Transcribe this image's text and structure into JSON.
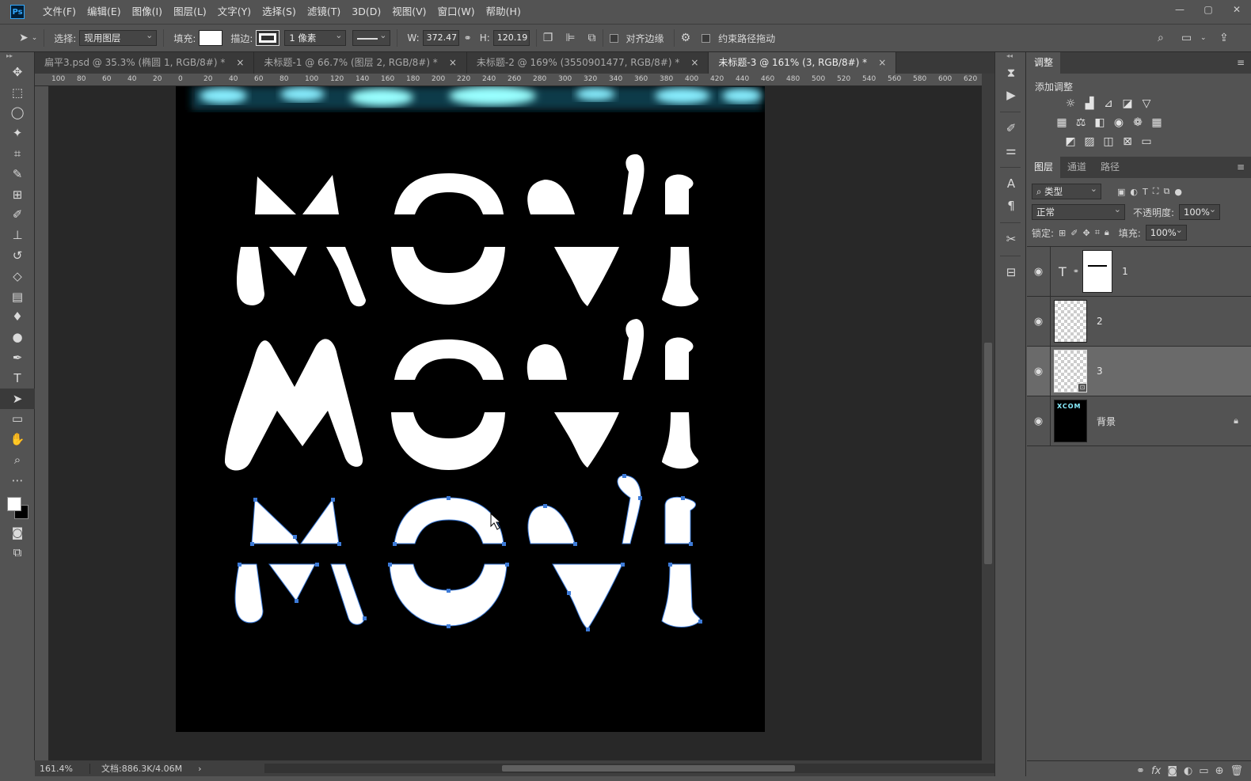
{
  "menubar": {
    "logo": "Ps",
    "items": [
      "文件(F)",
      "编辑(E)",
      "图像(I)",
      "图层(L)",
      "文字(Y)",
      "选择(S)",
      "滤镜(T)",
      "3D(D)",
      "视图(V)",
      "窗口(W)",
      "帮助(H)"
    ]
  },
  "options": {
    "select_label": "选择:",
    "select_value": "现用图层",
    "fill_label": "填充:",
    "stroke_label": "描边:",
    "stroke_width": "1 像素",
    "w_label": "W:",
    "w_value": "372.47 |",
    "h_label": "H:",
    "h_value": "120.19 |",
    "align_edges": "对齐边缘",
    "constrain_path": "约束路径拖动"
  },
  "tabs": [
    {
      "label": "扁平3.psd @ 35.3% (椭圆 1, RGB/8#) *",
      "close": "×"
    },
    {
      "label": "未标题-1 @ 66.7% (图层 2, RGB/8#) *",
      "close": "×"
    },
    {
      "label": "未标题-2 @ 169% (3550901477, RGB/8#) *",
      "close": "×"
    },
    {
      "label": "未标题-3 @ 161% (3, RGB/8#) *",
      "close": "×"
    }
  ],
  "ruler_top": [
    "100",
    "80",
    "60",
    "40",
    "20",
    "0",
    "20",
    "40",
    "60",
    "80",
    "100",
    "120",
    "140",
    "160",
    "180",
    "200",
    "220",
    "240",
    "260",
    "280",
    "300",
    "320",
    "340",
    "360",
    "380",
    "400",
    "420",
    "440",
    "460",
    "480",
    "500",
    "520",
    "540",
    "560",
    "580",
    "600",
    "620"
  ],
  "canvas": {
    "word": "MOVI"
  },
  "status": {
    "zoom": "161.4%",
    "doc_info": "文档:886.3K/4.06M"
  },
  "adjust_panel": {
    "tab": "调整",
    "add_label": "添加调整"
  },
  "layers_panel": {
    "tabs": [
      "图层",
      "通道",
      "路径"
    ],
    "filter_kind": "类型",
    "blend_mode": "正常",
    "opacity_label": "不透明度:",
    "opacity_value": "100%",
    "lock_label": "锁定:",
    "fill_label": "填充:",
    "fill_value": "100%",
    "layers": [
      {
        "name": "1",
        "type": "text"
      },
      {
        "name": "2",
        "type": "pixel"
      },
      {
        "name": "3",
        "type": "shape",
        "selected": true
      },
      {
        "name": "背景",
        "type": "background",
        "locked": true
      }
    ],
    "bg_thumb_text": "XCOM"
  },
  "colors": {
    "accent": "#31a8ff",
    "canvas_bg": "#000000",
    "app_bg": "#535353",
    "path_anchor": "#3d7bd8"
  }
}
